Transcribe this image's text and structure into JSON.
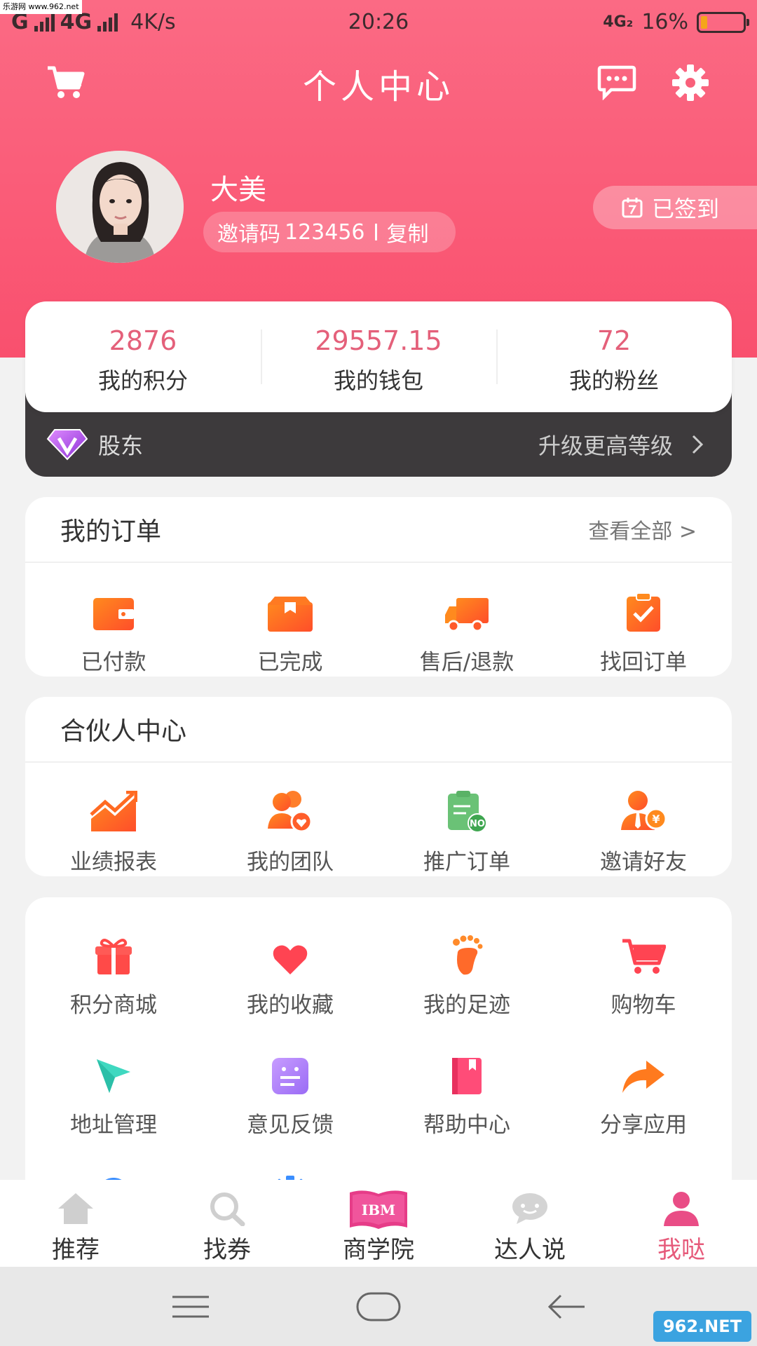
{
  "watermark_top": "乐游网 www.962.net",
  "status_bar": {
    "carrier": "G",
    "network": "4G",
    "speed": "4K/s",
    "time": "20:26",
    "net_right": "4G₂",
    "battery": "16%",
    "battery_level": 0.16
  },
  "header": {
    "title": "个人中心"
  },
  "profile": {
    "name": "大美",
    "invite_label": "邀请码",
    "invite_code": "123456",
    "copy_label": "复制",
    "signin_label": "已签到"
  },
  "stats": [
    {
      "value": "2876",
      "label": "我的积分"
    },
    {
      "value": "29557.15",
      "label": "我的钱包"
    },
    {
      "value": "72",
      "label": "我的粉丝"
    }
  ],
  "vip": {
    "level": "股东",
    "upgrade": "升级更高等级"
  },
  "orders": {
    "title": "我的订单",
    "more": "查看全部 >",
    "items": [
      {
        "label": "已付款",
        "icon": "wallet-icon"
      },
      {
        "label": "已完成",
        "icon": "box-icon"
      },
      {
        "label": "售后/退款",
        "icon": "truck-icon"
      },
      {
        "label": "找回订单",
        "icon": "clipboard-check-icon"
      }
    ]
  },
  "partner": {
    "title": "合伙人中心",
    "items": [
      {
        "label": "业绩报表",
        "icon": "trend-chart-icon"
      },
      {
        "label": "我的团队",
        "icon": "team-icon"
      },
      {
        "label": "推广订单",
        "icon": "promo-order-icon"
      },
      {
        "label": "邀请好友",
        "icon": "invite-friend-icon"
      }
    ]
  },
  "services": {
    "items": [
      {
        "label": "积分商城",
        "icon": "gift-icon"
      },
      {
        "label": "我的收藏",
        "icon": "heart-icon"
      },
      {
        "label": "我的足迹",
        "icon": "footprint-icon"
      },
      {
        "label": "购物车",
        "icon": "cart-icon"
      },
      {
        "label": "地址管理",
        "icon": "location-icon"
      },
      {
        "label": "意见反馈",
        "icon": "feedback-icon"
      },
      {
        "label": "帮助中心",
        "icon": "help-book-icon"
      },
      {
        "label": "分享应用",
        "icon": "share-icon"
      }
    ]
  },
  "bottom_nav": [
    {
      "label": "推荐",
      "icon": "home-icon"
    },
    {
      "label": "找券",
      "icon": "search-icon"
    },
    {
      "label": "商学院",
      "icon": "ibm-book-icon",
      "badge": "IBM"
    },
    {
      "label": "达人说",
      "icon": "chat-icon"
    },
    {
      "label": "我哒",
      "icon": "user-icon",
      "active": true
    }
  ],
  "watermark_bottom": "962.NET",
  "colors": {
    "primary": "#f9506e",
    "accent": "#e4607a",
    "vip_bg": "#3d3a3c"
  }
}
